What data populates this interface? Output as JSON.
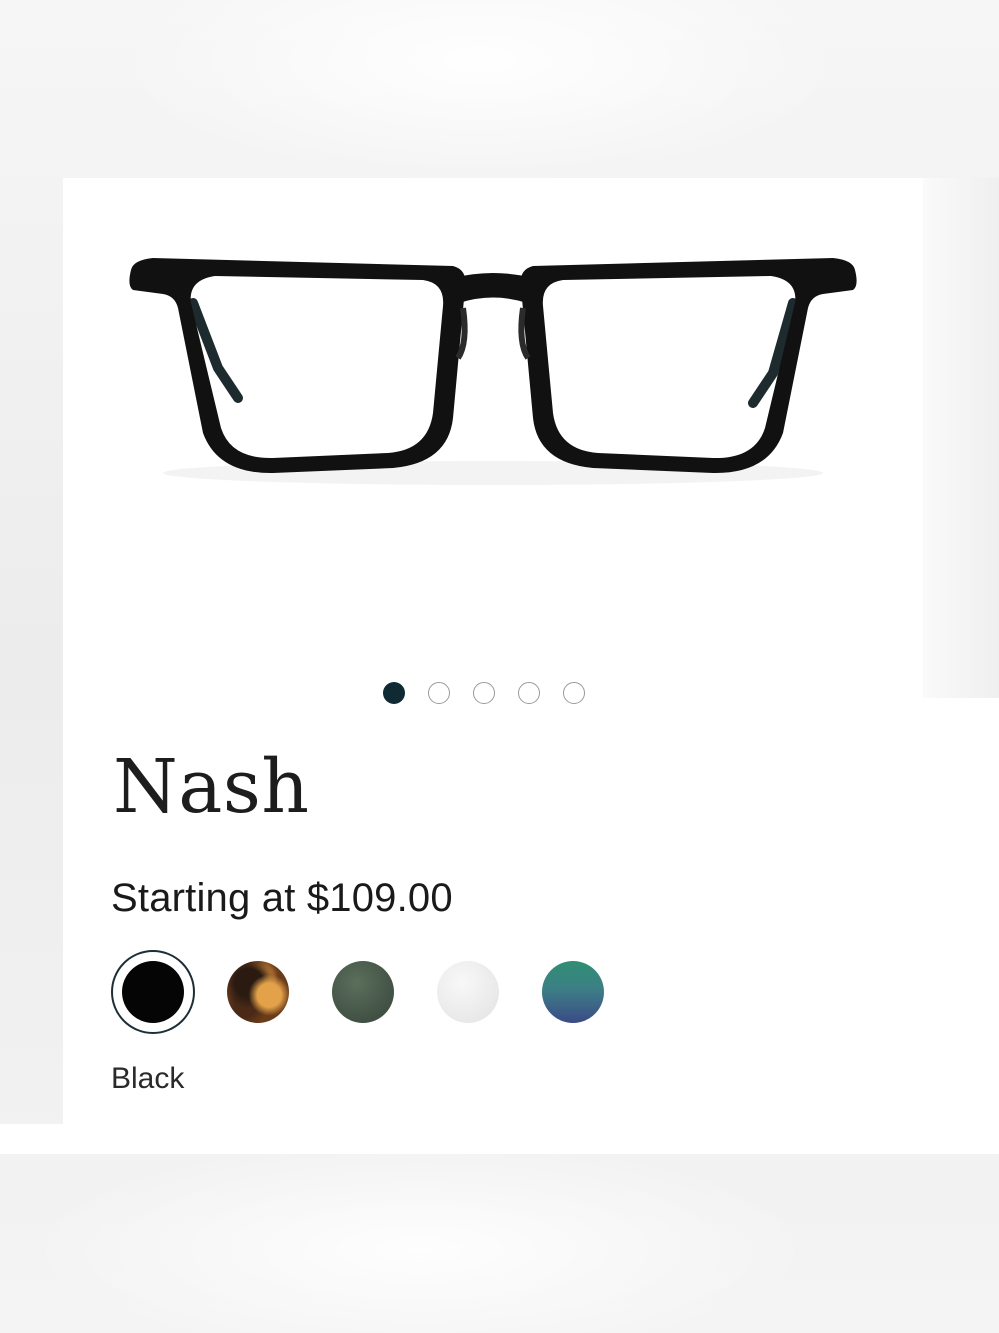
{
  "product": {
    "name": "Nash",
    "price_text": "Starting at $109.00",
    "selected_color": "Black"
  },
  "carousel": {
    "total_images": 5,
    "active_index": 0
  },
  "swatches": [
    {
      "name": "black-swatch",
      "color": "#050505",
      "selected": true
    },
    {
      "name": "tortoise-swatch",
      "color": "#6b3c1a",
      "selected": false
    },
    {
      "name": "green-swatch",
      "color": "#4a5a4b",
      "selected": false
    },
    {
      "name": "clear-swatch",
      "color": "#ececec",
      "selected": false
    },
    {
      "name": "teal-swatch",
      "color": "#2f8f73",
      "selected": false
    }
  ],
  "colors": {
    "accent": "#0f2a33",
    "text": "#1a1a1a"
  }
}
